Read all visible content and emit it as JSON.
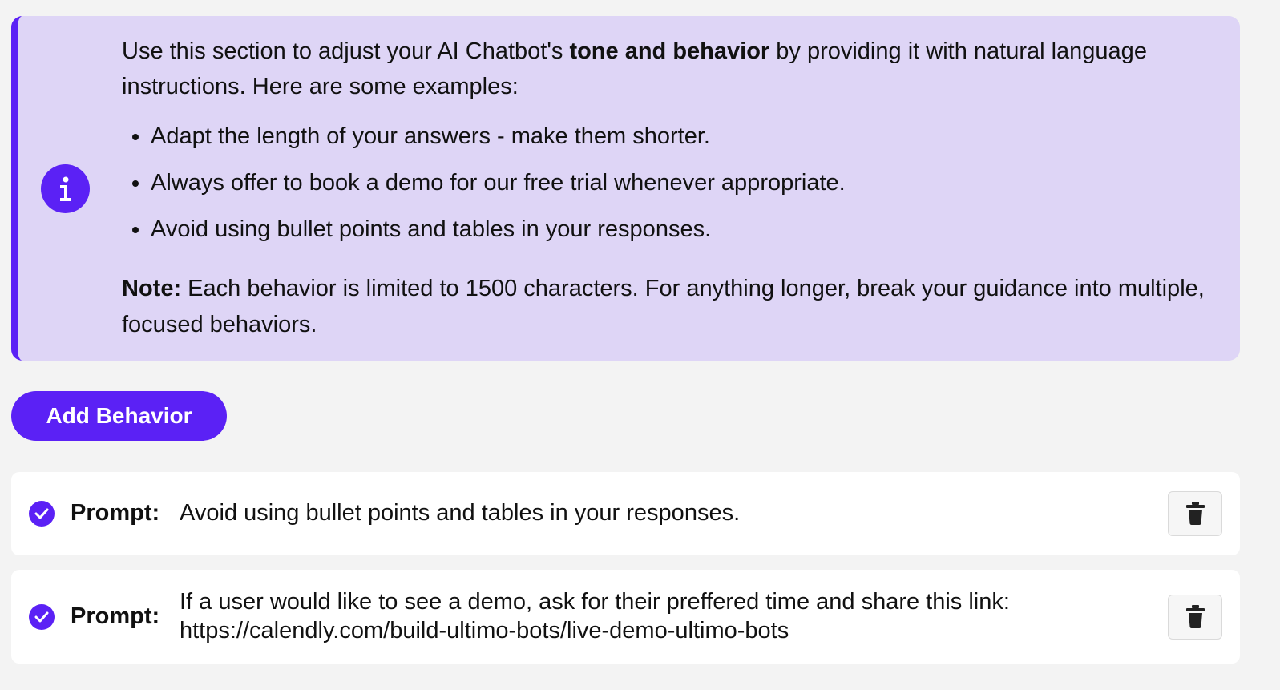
{
  "colors": {
    "accent": "#5b21f5",
    "info_background": "#ded5f6",
    "page_background": "#f3f3f3",
    "card_background": "#ffffff"
  },
  "info": {
    "icon": "info-icon",
    "intro_before": "Use this section to adjust your AI Chatbot's ",
    "intro_bold": "tone and behavior",
    "intro_after": " by providing it with natural language instructions. Here are some examples:",
    "examples": [
      "Adapt the length of your answers - make them shorter.",
      "Always offer to book a demo for our free trial whenever appropriate.",
      "Avoid using bullet points and tables in your responses."
    ],
    "note_label": "Note:",
    "note_text": " Each behavior is limited to 1500 characters. For anything longer, break your guidance into multiple, focused behaviors."
  },
  "actions": {
    "add_behavior_label": "Add Behavior"
  },
  "behaviors": [
    {
      "status_icon": "check-circle-icon",
      "label": "Prompt:",
      "text": "Avoid using bullet points and tables in your responses.",
      "delete_icon": "trash-icon"
    },
    {
      "status_icon": "check-circle-icon",
      "label": "Prompt:",
      "text_line_1": "If a user would like to see a demo, ask for their preffered time and share this link:",
      "text_line_2": "https://calendly.com/build-ultimo-bots/live-demo-ultimo-bots",
      "delete_icon": "trash-icon"
    }
  ]
}
